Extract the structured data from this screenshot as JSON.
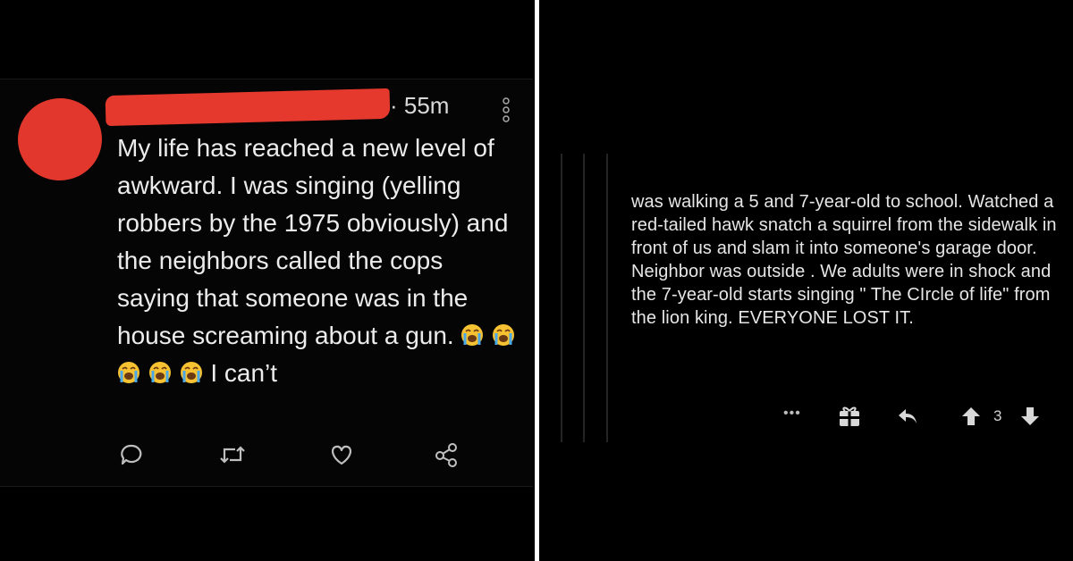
{
  "tweet": {
    "timestamp": "· 55m",
    "text": "My life has reached a new level of awkward. I was singing (yelling robbers by the 1975 obviously) and the neighbors called the cops saying that someone was in the house screaming about a gun.",
    "text_end": "I can’t",
    "emoji": "loudly-crying-face",
    "actions": [
      "reply-icon",
      "retweet-icon",
      "like-icon",
      "share-icon"
    ],
    "colors": {
      "redaction": "#e5392e",
      "text": "#ececec",
      "background": "#050505"
    }
  },
  "comment": {
    "text": "was walking a 5 and 7-year-old to school. Watched a red-tailed hawk snatch a squirrel from the sidewalk in front of us and slam it into someone's garage door. Neighbor was outside . We adults were in shock and the 7-year-old starts singing \" The CIrcle of life\" from the lion king. EVERYONE LOST IT.",
    "more_label": "•••",
    "vote_count": "3",
    "actions": [
      "more-icon",
      "award-icon",
      "reply-icon",
      "upvote-icon",
      "downvote-icon"
    ]
  }
}
